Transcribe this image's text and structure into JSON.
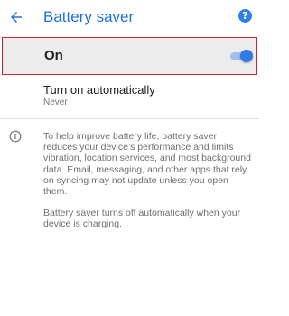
{
  "app_bar": {
    "back_icon": "arrow-back-icon",
    "title": "Battery saver",
    "help_icon": "help-icon",
    "help_glyph": "?"
  },
  "master_switch": {
    "label": "On",
    "state": "on",
    "accent_color": "#2f7be6"
  },
  "auto_setting": {
    "title": "Turn on automatically",
    "summary": "Never"
  },
  "info": {
    "icon": "info-icon",
    "paragraphs": [
      "To help improve battery life, battery saver reduces your device’s performance and limits vibration, location services, and most background data. Email, messaging, and other apps that rely on syncing may not update unless you open them.",
      "Battery saver turns off automatically when your device is charging."
    ]
  },
  "colors": {
    "title": "#1e6fdc",
    "highlight_border": "#d0222b"
  }
}
